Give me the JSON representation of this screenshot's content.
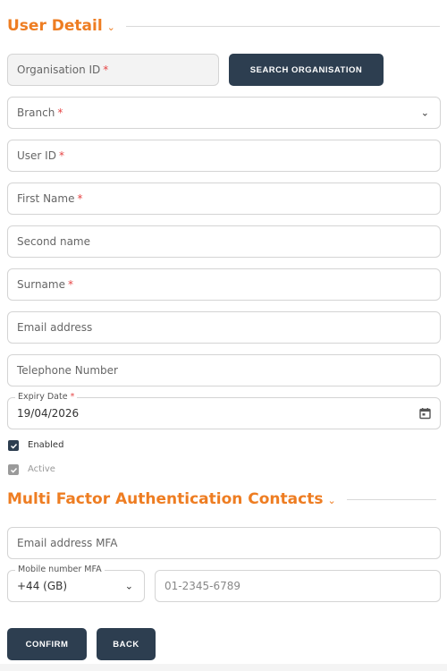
{
  "user_detail": {
    "title": "User Detail",
    "collapse_icon": "chevron-down-icon",
    "organisation_id": {
      "placeholder": "Organisation ID",
      "required": "*"
    },
    "search_organisation_label": "SEARCH ORGANISATION",
    "branch": {
      "placeholder": "Branch",
      "required": "*"
    },
    "user_id": {
      "placeholder": "User ID",
      "required": "*"
    },
    "first_name": {
      "placeholder": "First Name",
      "required": "*"
    },
    "second_name": {
      "placeholder": "Second name"
    },
    "surname": {
      "placeholder": "Surname",
      "required": "*"
    },
    "email": {
      "placeholder": "Email address"
    },
    "telephone": {
      "placeholder": "Telephone Number"
    },
    "expiry_date": {
      "label": "Expiry Date",
      "required": "*",
      "value": "19/04/2026",
      "icon": "calendar-icon"
    },
    "enabled": {
      "label": "Enabled",
      "checked": true
    },
    "active": {
      "label": "Active",
      "checked": true,
      "disabled": true
    }
  },
  "mfa": {
    "title": "Multi Factor Authentication Contacts",
    "email_mfa": {
      "placeholder": "Email address MFA"
    },
    "mobile_mfa": {
      "label": "Mobile number MFA",
      "country_code": "+44 (GB)",
      "number_placeholder": "01-2345-6789"
    }
  },
  "actions": {
    "confirm_label": "CONFIRM",
    "back_label": "BACK"
  },
  "colors": {
    "accent": "#ee7d22",
    "button": "#2d3e50",
    "required": "#e64545"
  }
}
